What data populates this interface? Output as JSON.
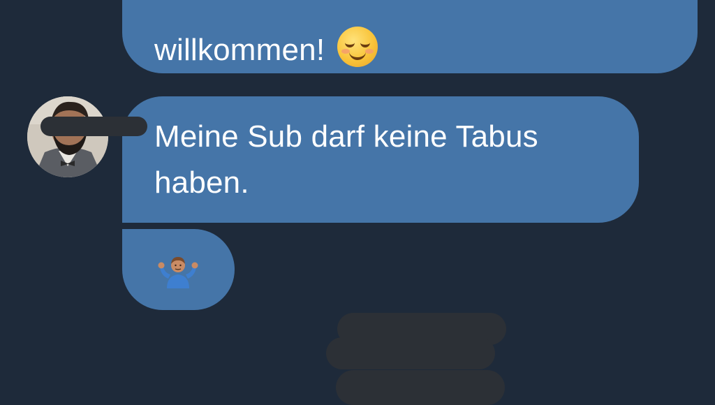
{
  "messages": [
    {
      "id": "msg-1",
      "partial_top_line": "... ... ...",
      "text": "willkommen!",
      "emoji": "smiling-face-with-smiling-eyes"
    },
    {
      "id": "msg-2",
      "line1": "Meine Sub darf keine Tabus",
      "line2": "haben."
    },
    {
      "id": "msg-3",
      "emoji": "person-shrugging"
    }
  ],
  "sender": {
    "avatar_icon": "avatar-photo",
    "name_redacted": true
  },
  "colors": {
    "background": "#1e2a3a",
    "bubble": "#4575a8",
    "redaction": "#2c3036",
    "text": "#ffffff"
  }
}
